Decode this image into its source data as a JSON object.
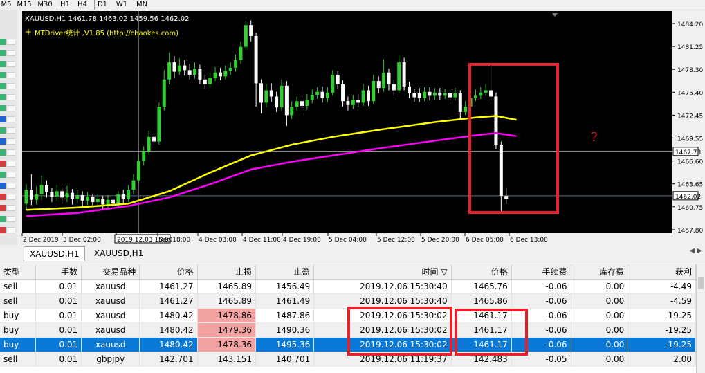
{
  "timeframes": [
    "M5",
    "M15",
    "M30",
    "H1",
    "H4",
    "D1",
    "W1",
    "MN"
  ],
  "chart": {
    "header_text": "XAUUSD,H1  1461.78 1463.02 1459.56 1462.02",
    "indicator_text": "MTDriver统计 ,V1.85 (http://chaokes.com)",
    "annotation": "?",
    "price_labels": [
      "1484.20",
      "1481.25",
      "1478.30",
      "1475.40",
      "1472.45",
      "1469.55",
      "1466.60",
      "1463.65",
      "1460.75",
      "1457.80"
    ],
    "crosshair_price": "1467.73",
    "current_price": "1462.02",
    "time_labels": [
      "2 Dec 2019",
      "3 Dec 02:00",
      "2019.12.03 15:00",
      "Dec 18:00",
      "4 Dec 03:00",
      "4 Dec 11:00",
      "4 Dec 19:00",
      "5 Dec 04:00",
      "5 Dec 12:00",
      "5 Dec 20:00",
      "6 Dec 05:00",
      "6 Dec 13:00"
    ]
  },
  "tabs": {
    "active": "XAUUSD,H1",
    "other": "XAUUSD,H1"
  },
  "table": {
    "headers": [
      "类型",
      "手数",
      "交易品种",
      "价格",
      "止损",
      "止盈",
      "时间 ▽",
      "价格",
      "手续费",
      "库存费",
      "获利"
    ],
    "rows": [
      [
        "sell",
        "0.01",
        "xauusd",
        "1461.27",
        "1465.89",
        "1456.49",
        "2019.12.06 15:30:40",
        "1465.76",
        "-0.06",
        "0.00",
        "-4.49"
      ],
      [
        "sell",
        "0.01",
        "xauusd",
        "1461.27",
        "1465.89",
        "1461.49",
        "2019.12.06 15:30:40",
        "1465.86",
        "-0.06",
        "0.00",
        "-4.59"
      ],
      [
        "buy",
        "0.01",
        "xauusd",
        "1480.42",
        "1478.86",
        "1487.86",
        "2019.12.06 15:30:02",
        "1461.17",
        "-0.06",
        "0.00",
        "-19.25"
      ],
      [
        "buy",
        "0.01",
        "xauusd",
        "1480.42",
        "1479.36",
        "1490.36",
        "2019.12.06 15:30:02",
        "1461.17",
        "-0.06",
        "0.00",
        "-19.25"
      ],
      [
        "buy",
        "0.01",
        "xauusd",
        "1480.42",
        "1478.36",
        "1495.36",
        "2019.12.06 15:30:02",
        "1461.17",
        "-0.06",
        "0.00",
        "-19.25"
      ],
      [
        "sell",
        "0.01",
        "gbpjpy",
        "142.701",
        "143.151",
        "140.701",
        "2019.12.06 11:19:37",
        "142.483",
        "-0.05",
        "0.00",
        "2.00"
      ]
    ]
  },
  "colors": {
    "bg": "#000000",
    "bull": "#32cd32",
    "bear": "#ffffff",
    "ma_fast": "#ffff00",
    "ma_slow": "#ff00ff",
    "highlight_box": "#e8202a",
    "sel_row": "#0a78d7",
    "sl_highlight": "#f4a3a3"
  }
}
